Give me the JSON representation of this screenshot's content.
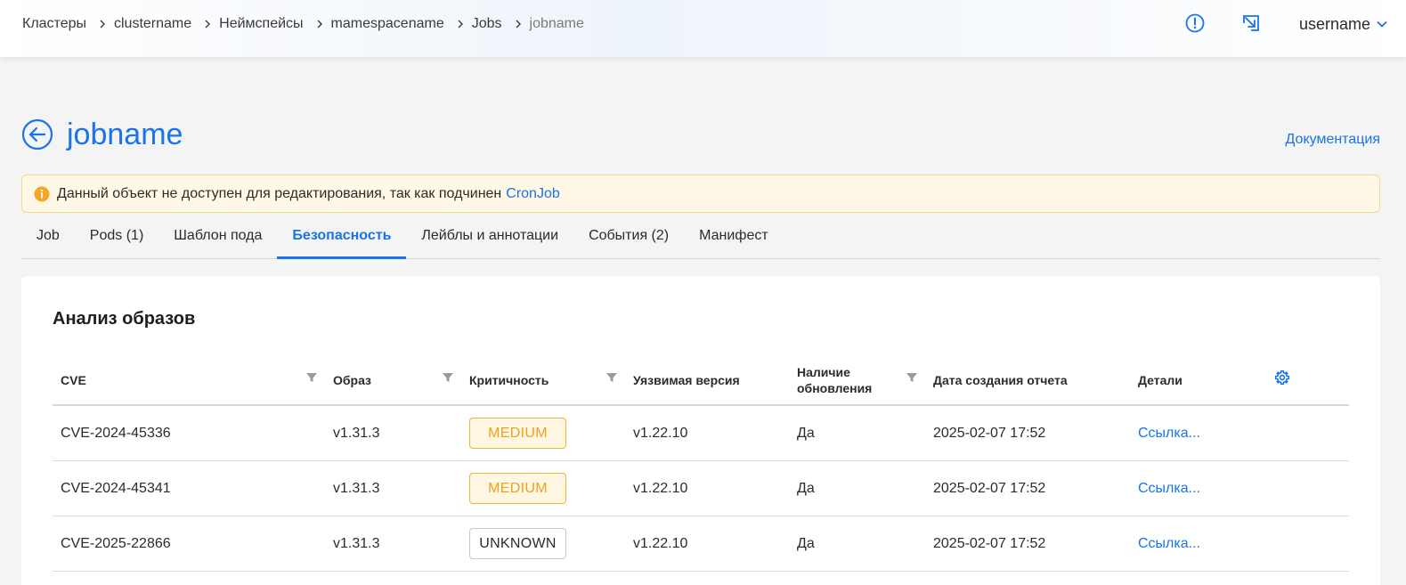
{
  "breadcrumb": [
    {
      "label": "Кластеры"
    },
    {
      "label": "clustername"
    },
    {
      "label": "Неймспейсы"
    },
    {
      "label": "mamespacename"
    },
    {
      "label": "Jobs"
    },
    {
      "label": "jobname"
    }
  ],
  "header": {
    "username": "username",
    "icons": [
      "alert-circle-icon",
      "arrow-down-right-box-icon",
      "chevron-down-icon"
    ]
  },
  "page": {
    "title": "jobname",
    "doc_link": "Документация"
  },
  "alert": {
    "text": "Данный объект не доступен для редактирования, так как подчинен",
    "link": "CronJob"
  },
  "tabs": [
    {
      "label": "Job"
    },
    {
      "label": "Pods (1)"
    },
    {
      "label": "Шаблон пода"
    },
    {
      "label": "Безопасность",
      "active": true
    },
    {
      "label": "Лейблы и аннотации"
    },
    {
      "label": "События (2)"
    },
    {
      "label": "Манифест"
    }
  ],
  "section": {
    "title": "Анализ образов"
  },
  "table": {
    "columns": [
      {
        "label": "CVE"
      },
      {
        "label": "Образ"
      },
      {
        "label": "Критичность"
      },
      {
        "label": "Уязвимая версия"
      },
      {
        "label_line1": "Наличие",
        "label_line2": "обновления"
      },
      {
        "label": "Дата создания отчета"
      },
      {
        "label": "Детали"
      }
    ],
    "rows": [
      {
        "cve": "CVE-2024-45336",
        "image": "v1.31.3",
        "severity": "MEDIUM",
        "vuln_version": "v1.22.10",
        "update": "Да",
        "date": "2025-02-07 17:52",
        "details": "Ссылка..."
      },
      {
        "cve": "CVE-2024-45341",
        "image": "v1.31.3",
        "severity": "MEDIUM",
        "vuln_version": "v1.22.10",
        "update": "Да",
        "date": "2025-02-07 17:52",
        "details": "Ссылка..."
      },
      {
        "cve": "CVE-2025-22866",
        "image": "v1.31.3",
        "severity": "UNKNOWN",
        "vuln_version": "v1.22.10",
        "update": "Да",
        "date": "2025-02-07 17:52",
        "details": "Ссылка..."
      }
    ]
  },
  "colors": {
    "accent": "#1a73e8",
    "alert_bg": "#fff8e6",
    "alert_icon": "#f5a623",
    "medium": "#f0a020"
  }
}
